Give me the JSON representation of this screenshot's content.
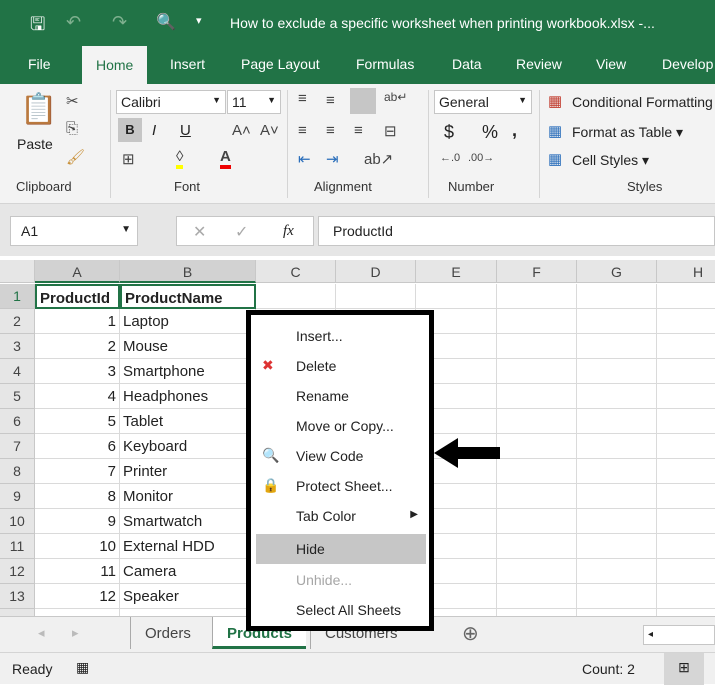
{
  "titlebar": {
    "title": "How to exclude a specific worksheet when printing workbook.xlsx  -..."
  },
  "ribbon_tabs": [
    "File",
    "Home",
    "Insert",
    "Page Layout",
    "Formulas",
    "Data",
    "Review",
    "View",
    "Develop"
  ],
  "ribbon": {
    "paste": "Paste",
    "font_name": "Calibri",
    "font_size": "11",
    "number_format": "General",
    "conditional": "Conditional Formatting",
    "format_table": "Format as Table",
    "cell_styles": "Cell Styles",
    "groups": [
      "Clipboard",
      "Font",
      "Alignment",
      "Number",
      "Styles"
    ],
    "bold": "B",
    "italic": "I",
    "underline": "U",
    "currency": "$",
    "percent": "%",
    "comma": ","
  },
  "formula": {
    "name_box": "A1",
    "fx": "fx",
    "value": "ProductId"
  },
  "columns": [
    "A",
    "B",
    "C",
    "D",
    "E",
    "F",
    "G",
    "H"
  ],
  "rows": [
    [
      "ProductId",
      "ProductName"
    ],
    [
      "1",
      "Laptop"
    ],
    [
      "2",
      "Mouse"
    ],
    [
      "3",
      "Smartphone"
    ],
    [
      "4",
      "Headphones"
    ],
    [
      "5",
      "Tablet"
    ],
    [
      "6",
      "Keyboard"
    ],
    [
      "7",
      "Printer"
    ],
    [
      "8",
      "Monitor"
    ],
    [
      "9",
      "Smartwatch"
    ],
    [
      "10",
      "External HDD"
    ],
    [
      "11",
      "Camera"
    ],
    [
      "12",
      "Speaker"
    ]
  ],
  "context_menu": [
    {
      "label": "Insert...",
      "icon": ""
    },
    {
      "label": "Delete",
      "icon": "delete-sheet-icon"
    },
    {
      "label": "Rename",
      "icon": ""
    },
    {
      "label": "Move or Copy...",
      "icon": ""
    },
    {
      "label": "View Code",
      "icon": "view-code-icon"
    },
    {
      "label": "Protect Sheet...",
      "icon": "protect-sheet-icon"
    },
    {
      "label": "Tab Color",
      "icon": "",
      "submenu": true
    },
    {
      "label": "Hide",
      "icon": "",
      "highlighted": true
    },
    {
      "label": "Unhide...",
      "icon": "",
      "disabled": true
    },
    {
      "label": "Select All Sheets",
      "icon": ""
    }
  ],
  "sheets": [
    "Orders",
    "Products",
    "Customers"
  ],
  "active_sheet": "Products",
  "status": {
    "ready": "Ready",
    "count": "Count: 2"
  },
  "colors": {
    "accent": "#217346"
  }
}
